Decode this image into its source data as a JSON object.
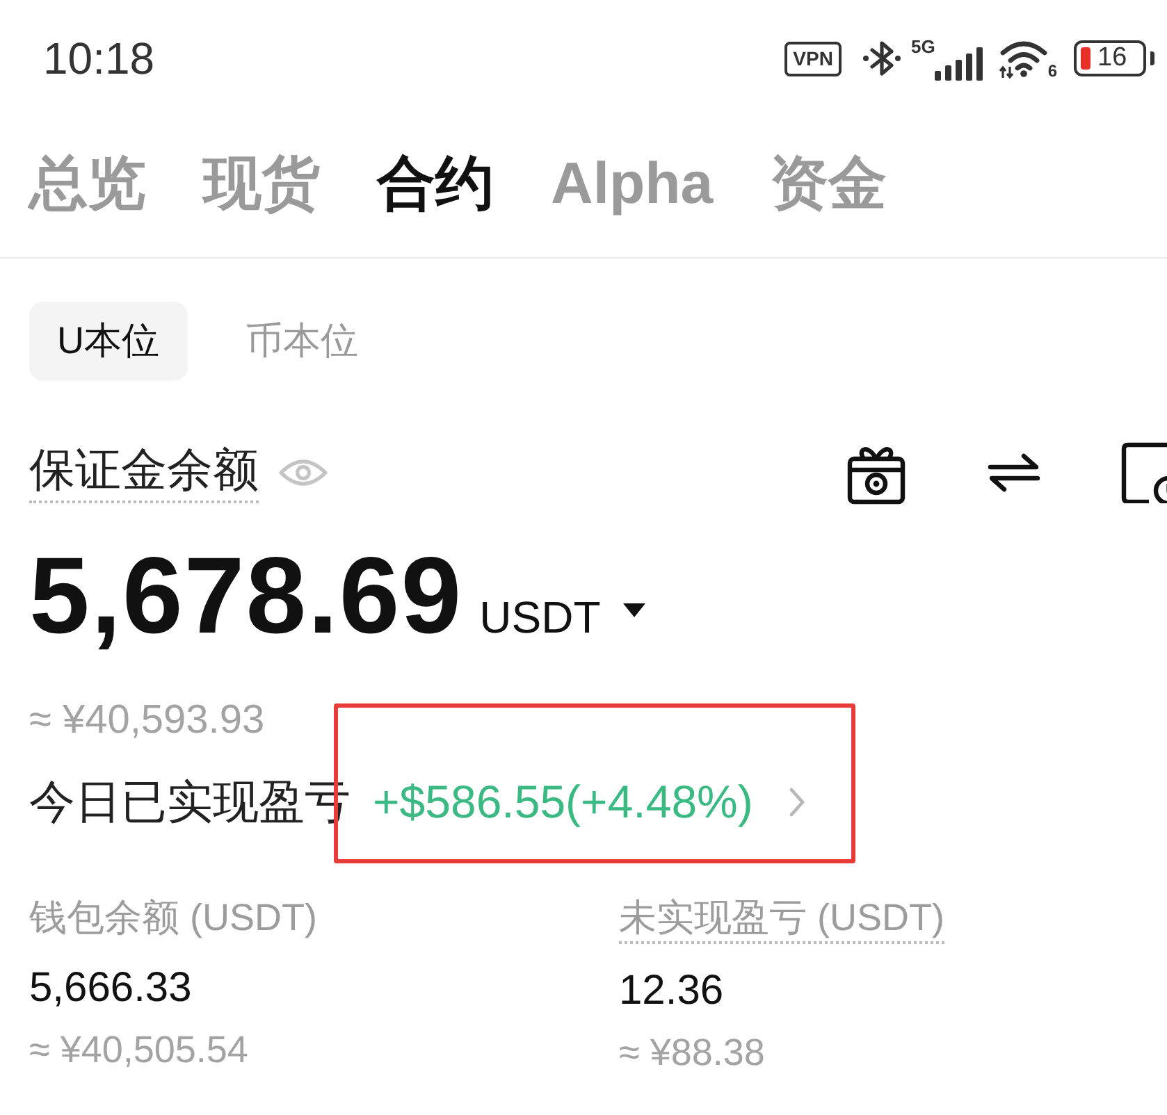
{
  "status_bar": {
    "time": "10:18",
    "vpn_badge": "VPN",
    "network_type": "5G",
    "wifi_standard": "6",
    "battery": "16"
  },
  "main_tabs": [
    {
      "label": "总览",
      "selected": false
    },
    {
      "label": "现货",
      "selected": false
    },
    {
      "label": "合约",
      "selected": true
    },
    {
      "label": "Alpha",
      "selected": false
    },
    {
      "label": "资金",
      "selected": false
    }
  ],
  "sub_tabs": [
    {
      "label": "U本位",
      "selected": true
    },
    {
      "label": "币本位",
      "selected": false
    }
  ],
  "margin_balance": {
    "label": "保证金余额",
    "dotted_underline": true,
    "value": "5,678.69",
    "currency": "USDT",
    "approx": "≈ ¥40,593.93"
  },
  "today_pnl": {
    "label": "今日已实现盈亏",
    "value": "+$586.55(+4.48%)",
    "annotated": true
  },
  "balances": [
    {
      "label": "钱包余额 (USDT)",
      "dotted_underline": false,
      "value": "5,666.33",
      "approx": "≈ ¥40,505.54"
    },
    {
      "label": "未实现盈亏 (USDT)",
      "dotted_underline": true,
      "value": "12.36",
      "approx": "≈ ¥88.38"
    }
  ]
}
